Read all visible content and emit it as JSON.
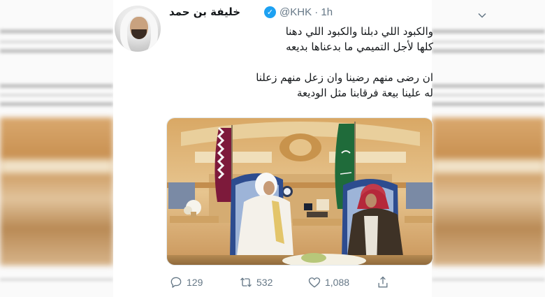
{
  "tweet": {
    "author_name": "خليفة بن حمد",
    "handle_time": "@KHK · 1h",
    "lines": [
      "والكبود اللي دبلنا والكبود اللي دهنا",
      "كلها لأجل التميمي ما بدعناها بديعه",
      "",
      "ان رضى منهم رضينا وان زعل منهم زعلنا",
      "له علينا بيعة فرقابنا مثل الوديعة"
    ],
    "replies": "129",
    "retweets": "532",
    "likes": "1,088"
  },
  "icons": {
    "verified": "verified-badge-icon",
    "chevron": "chevron-down-icon",
    "reply": "reply-icon",
    "retweet": "retweet-icon",
    "like": "heart-icon",
    "share": "share-icon"
  },
  "colors": {
    "accent": "#1da1f2",
    "muted": "#657786",
    "text": "#14171a"
  }
}
